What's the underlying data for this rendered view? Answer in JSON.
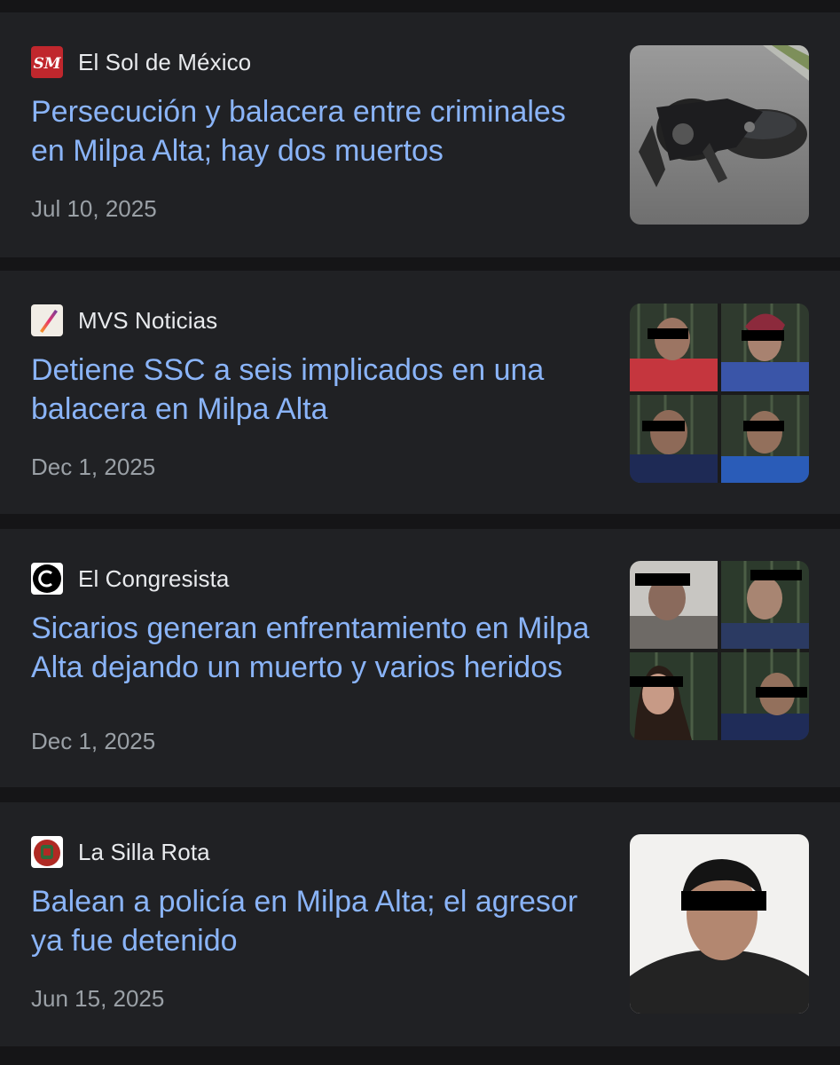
{
  "articles": [
    {
      "source": "El Sol de México",
      "logo_text": "SM",
      "logo_color": "#c0272d",
      "title": "Persecución y balacera entre criminales en Milpa Alta; hay dos muertos",
      "date": "Jul 10, 2025",
      "thumbnail": "crashed-motorcycle-image"
    },
    {
      "source": "MVS Noticias",
      "logo_color": "#e8e3da",
      "title": "Detiene SSC a seis implicados en una balacera en Milpa Alta",
      "date": "Dec 1, 2025",
      "thumbnail": "detainees-grid-image"
    },
    {
      "source": "El Congresista",
      "logo_color": "#000000",
      "title": "Sicarios generan enfrentamiento en Milpa Alta dejando un muerto y varios heridos",
      "date": "Dec 1, 2025",
      "thumbnail": "detainees-grid-image-2"
    },
    {
      "source": "La Silla Rota",
      "logo_color": "#b02a24",
      "title": "Balean a policía en Milpa Alta; el agresor ya fue detenido",
      "date": "Jun 15, 2025",
      "thumbnail": "detainee-portrait-image"
    }
  ],
  "colors": {
    "background": "#151517",
    "card": "#202124",
    "title_link": "#8ab4f8",
    "source_text": "#e8eaed",
    "date_text": "#9aa0a6"
  }
}
